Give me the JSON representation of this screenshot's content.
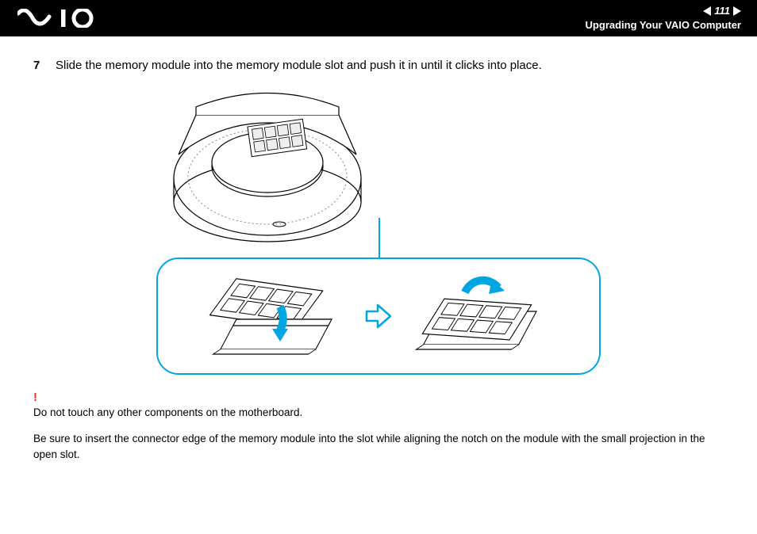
{
  "header": {
    "logo_alt": "VAIO",
    "page_number": "111",
    "section_title": "Upgrading Your VAIO Computer"
  },
  "step": {
    "number": "7",
    "text": "Slide the memory module into the memory module slot and push it in until it clicks into place."
  },
  "warning": {
    "mark": "!",
    "text": "Do not touch any other components on the motherboard."
  },
  "note": {
    "text": "Be sure to insert the connector edge of the memory module into the slot while aligning the notch on the module with the small projection in the open slot."
  }
}
